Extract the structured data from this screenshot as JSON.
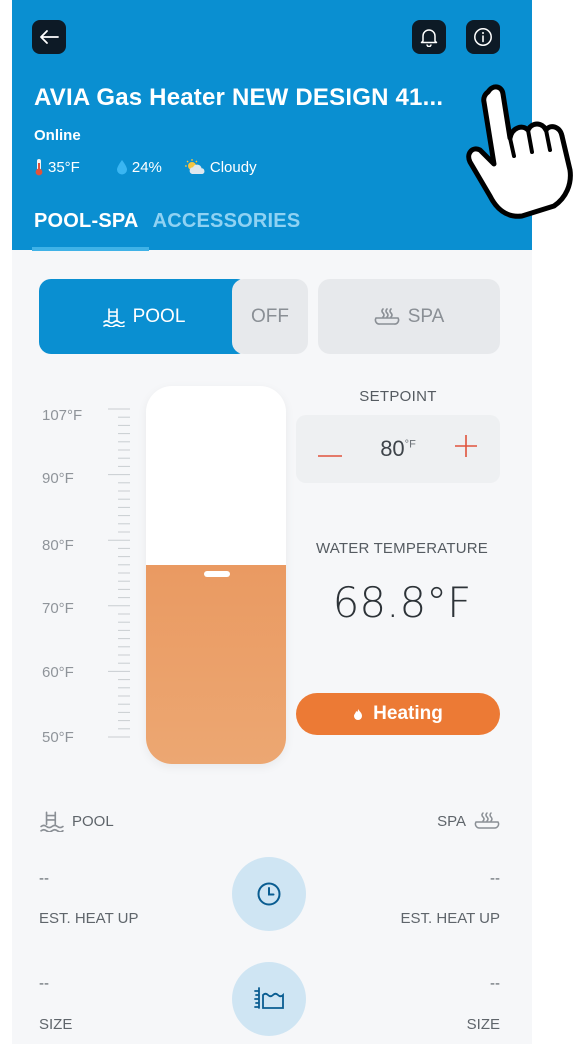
{
  "header": {
    "title": "AVIA Gas Heater NEW DESIGN 41...",
    "status": "Online",
    "weather": {
      "temperature": "35°F",
      "humidity": "24%",
      "condition": "Cloudy"
    },
    "colors": {
      "header_bg": "#0a8fd1",
      "accent_orange": "#ec7a35"
    }
  },
  "tabs": [
    {
      "label": "POOL-SPA",
      "active": true
    },
    {
      "label": "ACCESSORIES",
      "active": false
    }
  ],
  "modes": {
    "pool": "POOL",
    "off": "OFF",
    "spa": "SPA",
    "selected": "POOL"
  },
  "scale": {
    "labels": [
      "107°F",
      "90°F",
      "80°F",
      "70°F",
      "60°F",
      "50°F"
    ]
  },
  "thermometer": {
    "water_temp_value": 68.8
  },
  "setpoint": {
    "label": "SETPOINT",
    "value": "80",
    "unit": "°F",
    "minus": "—",
    "plus": "+"
  },
  "water_temperature": {
    "label": "WATER TEMPERATURE",
    "value": "68.8°F"
  },
  "heating": {
    "label": "Heating"
  },
  "bottom": {
    "pool_label": "POOL",
    "spa_label": "SPA",
    "pool_heatup_value": "--",
    "spa_heatup_value": "--",
    "heatup_label": "EST. HEAT UP",
    "pool_size_value": "--",
    "spa_size_value": "--",
    "size_label": "SIZE"
  }
}
